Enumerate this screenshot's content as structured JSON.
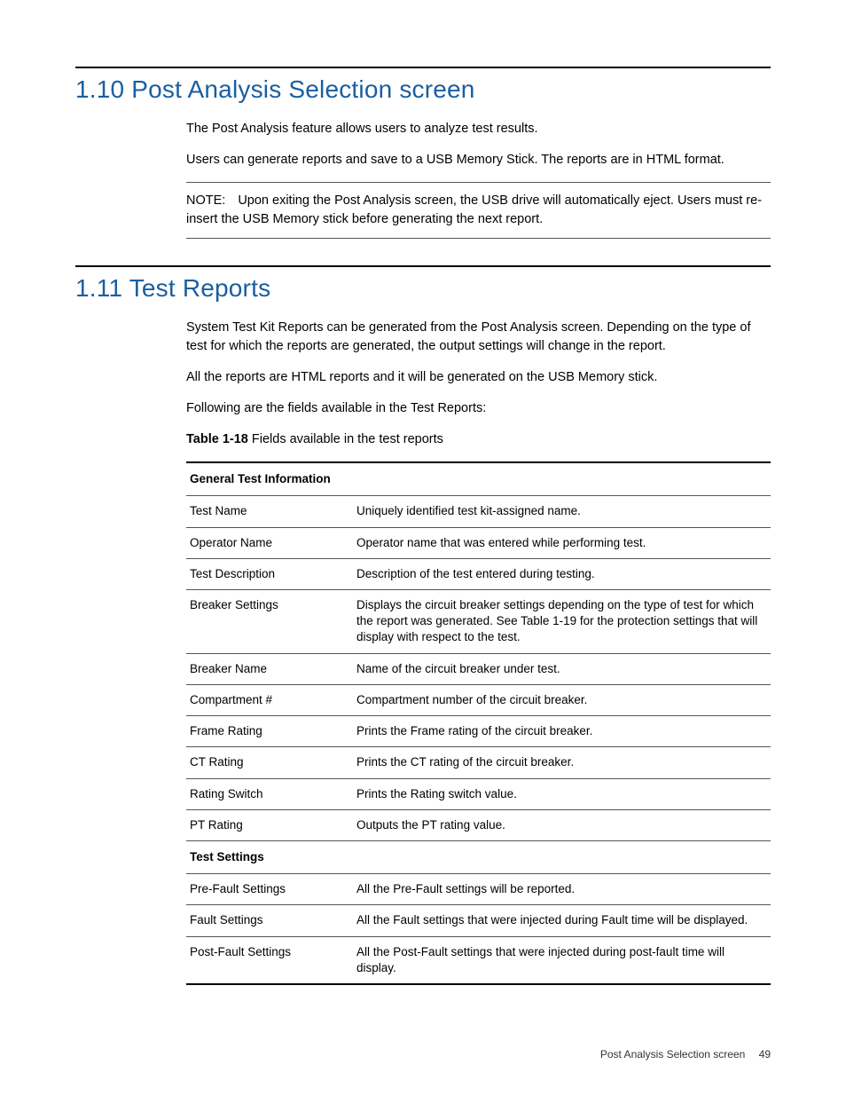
{
  "section1": {
    "heading": "1.10 Post Analysis Selection screen",
    "para1": "The Post Analysis feature allows users to analyze test results.",
    "para2": "Users can generate reports and save to a USB Memory Stick. The reports are in HTML format.",
    "note_label": "NOTE:",
    "note_text": "Upon exiting the Post Analysis screen, the USB drive will automatically eject. Users must re-insert the USB Memory stick before generating the next report."
  },
  "section2": {
    "heading": "1.11 Test Reports",
    "para1": "System Test Kit Reports can be generated from the Post Analysis screen. Depending on the type of test for which the reports are generated, the output settings will change in the report.",
    "para2": "All the reports are HTML reports and it will be generated on the USB Memory stick.",
    "para3": "Following are the fields available in the Test Reports:",
    "table_caption_num": "Table 1-18",
    "table_caption_text": "  Fields available in the test reports"
  },
  "table": {
    "group1_header": "General Test Information",
    "group1_rows": [
      {
        "label": "Test Name",
        "desc": "Uniquely identified test kit-assigned name."
      },
      {
        "label": "Operator Name",
        "desc": "Operator name that was entered while performing test."
      },
      {
        "label": "Test Description",
        "desc": "Description of the test entered during testing."
      },
      {
        "label": "Breaker Settings",
        "desc": "Displays the circuit breaker settings depending on the type of test for which the report was generated. See Table 1-19 for the protection settings that will display with respect to the test."
      },
      {
        "label": "Breaker Name",
        "desc": "Name of the circuit breaker under test."
      },
      {
        "label": "Compartment #",
        "desc": "Compartment number of the circuit breaker."
      },
      {
        "label": "Frame Rating",
        "desc": "Prints the Frame rating of the circuit breaker."
      },
      {
        "label": "CT Rating",
        "desc": "Prints the CT rating of the circuit breaker."
      },
      {
        "label": "Rating Switch",
        "desc": "Prints the Rating switch value."
      },
      {
        "label": "PT Rating",
        "desc": "Outputs the PT rating value."
      }
    ],
    "group2_header": "Test Settings",
    "group2_rows": [
      {
        "label": "Pre-Fault Settings",
        "desc": "All the Pre-Fault settings will be reported."
      },
      {
        "label": "Fault Settings",
        "desc": "All the Fault settings that were injected during Fault time will be displayed."
      },
      {
        "label": "Post-Fault Settings",
        "desc": "All the Post-Fault settings that were injected during post-fault time will display."
      }
    ]
  },
  "footer": {
    "title": "Post Analysis Selection screen",
    "page": "49"
  }
}
